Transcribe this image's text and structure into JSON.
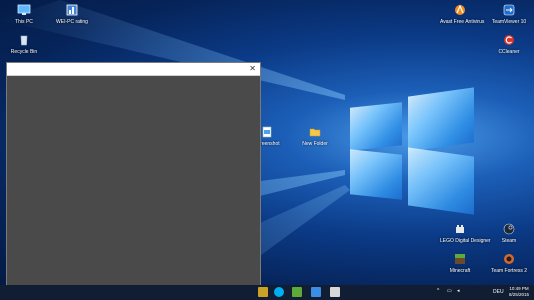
{
  "desktop_icons": {
    "this_pc": "This PC",
    "wei_rating": "WEI-PC rating",
    "recycle_bin": "Recycle Bin",
    "avast": "Avast Free Antivirus",
    "teamviewer": "TeamViewer 10",
    "ccleaner": "CCleaner",
    "screenshot": "Screenshot",
    "new_folder": "New Folder",
    "lego": "LEGO Digital Designer",
    "steam": "Steam",
    "minecraft": "Minecraft",
    "tf2": "Team Fortress 2"
  },
  "window": {
    "close_glyph": "✕"
  },
  "taskbar": {
    "language": "DEU",
    "clock_time": "10:49 PM",
    "clock_date": "8/25/2015"
  }
}
